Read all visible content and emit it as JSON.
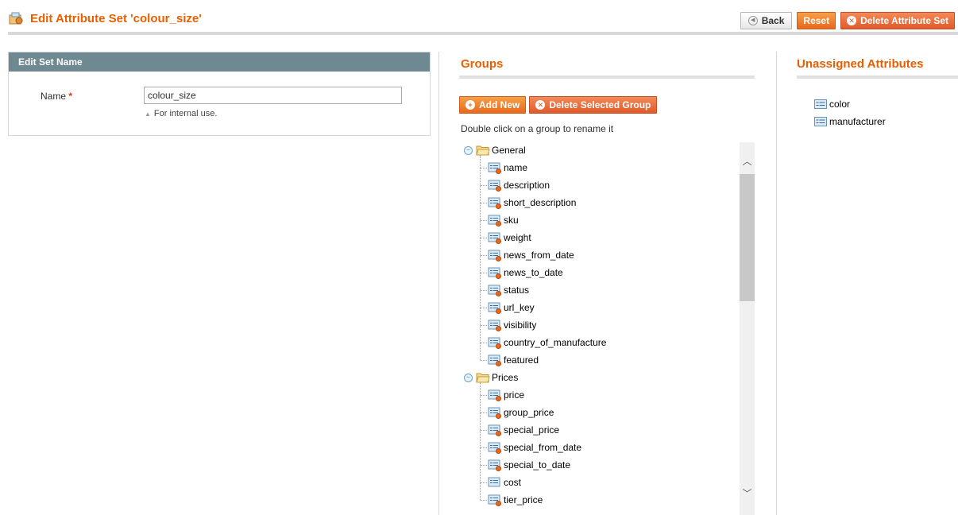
{
  "header": {
    "title": "Edit Attribute Set 'colour_size'",
    "buttons": {
      "back": "Back",
      "reset": "Reset",
      "delete_set": "Delete Attribute Set"
    }
  },
  "set_name_panel": {
    "heading": "Edit Set Name",
    "name_label": "Name",
    "required_marker": "*",
    "name_value": "colour_size",
    "note": "For internal use."
  },
  "groups": {
    "title": "Groups",
    "add_new": "Add New",
    "delete_group": "Delete Selected Group",
    "hint": "Double click on a group to rename it",
    "tree": [
      {
        "label": "General",
        "items": [
          "name",
          "description",
          "short_description",
          "sku",
          "weight",
          "news_from_date",
          "news_to_date",
          "status",
          "url_key",
          "visibility",
          "country_of_manufacture",
          "featured"
        ]
      },
      {
        "label": "Prices",
        "items": [
          "price",
          "group_price",
          "special_price",
          "special_from_date",
          "special_to_date",
          "cost",
          "tier_price"
        ]
      }
    ],
    "plain_items": [
      "cost"
    ]
  },
  "unassigned": {
    "title": "Unassigned Attributes",
    "items": [
      "color",
      "manufacturer"
    ]
  },
  "colors": {
    "accent": "#eb5e00",
    "panel_header": "#6f8992",
    "button_orange": "#e8681d",
    "button_red": "#e05a2a"
  },
  "icons": {
    "title": "attribute-set-icon",
    "group": "folder-icon",
    "system_attribute": "system-attribute-icon",
    "user_attribute": "attribute-icon"
  }
}
